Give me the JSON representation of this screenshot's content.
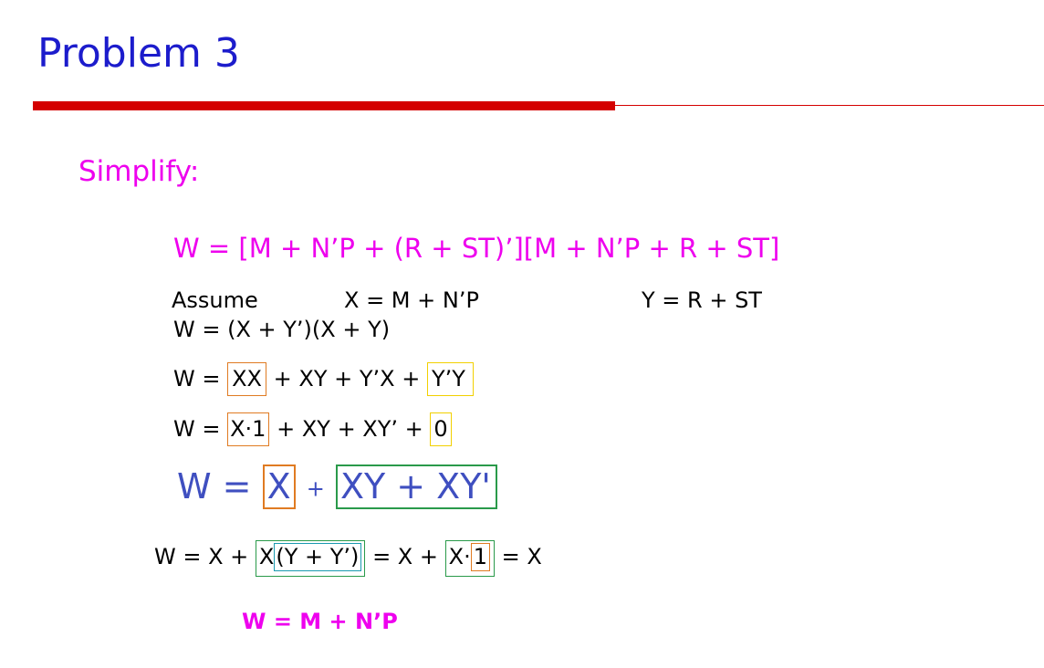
{
  "title": "Problem 3",
  "subtitle": "Simplify:",
  "equation": "W = [M + N’P + (R + ST)’][M + N’P + R + ST]",
  "assume": {
    "label": "Assume",
    "x_def": "X = M + N’P",
    "y_def": "Y = R + ST"
  },
  "steps": {
    "s1": "W = (X + Y’)(X + Y)",
    "s2": {
      "prefix": "W =",
      "xx": "XX",
      "mid": "+ XY + Y’X +",
      "yy": "Y’Y"
    },
    "s3": {
      "prefix": "W =",
      "x1": "X·1",
      "mid": "+ XY + XY’ +",
      "zero": "0"
    },
    "s4": {
      "prefix": "W =",
      "x": "X",
      "plus": "+",
      "rest": "XY + XY'"
    },
    "s5": {
      "prefix": "W = X +",
      "x": "X",
      "paren": "(Y + Y’)",
      "mid": "= X +",
      "xdot": "X·",
      "one": "1",
      "end": "= X"
    }
  },
  "result": "W = M + N’P",
  "colors": {
    "title": "#1c1ccc",
    "accent_bar": "#d40000",
    "magenta": "#ee00ee",
    "big_step": "#3f4fc0",
    "orange_box": "#e07b22",
    "yellow_box": "#f2d000",
    "green_box": "#2a9a4a",
    "teal_box": "#1a9ab0"
  }
}
